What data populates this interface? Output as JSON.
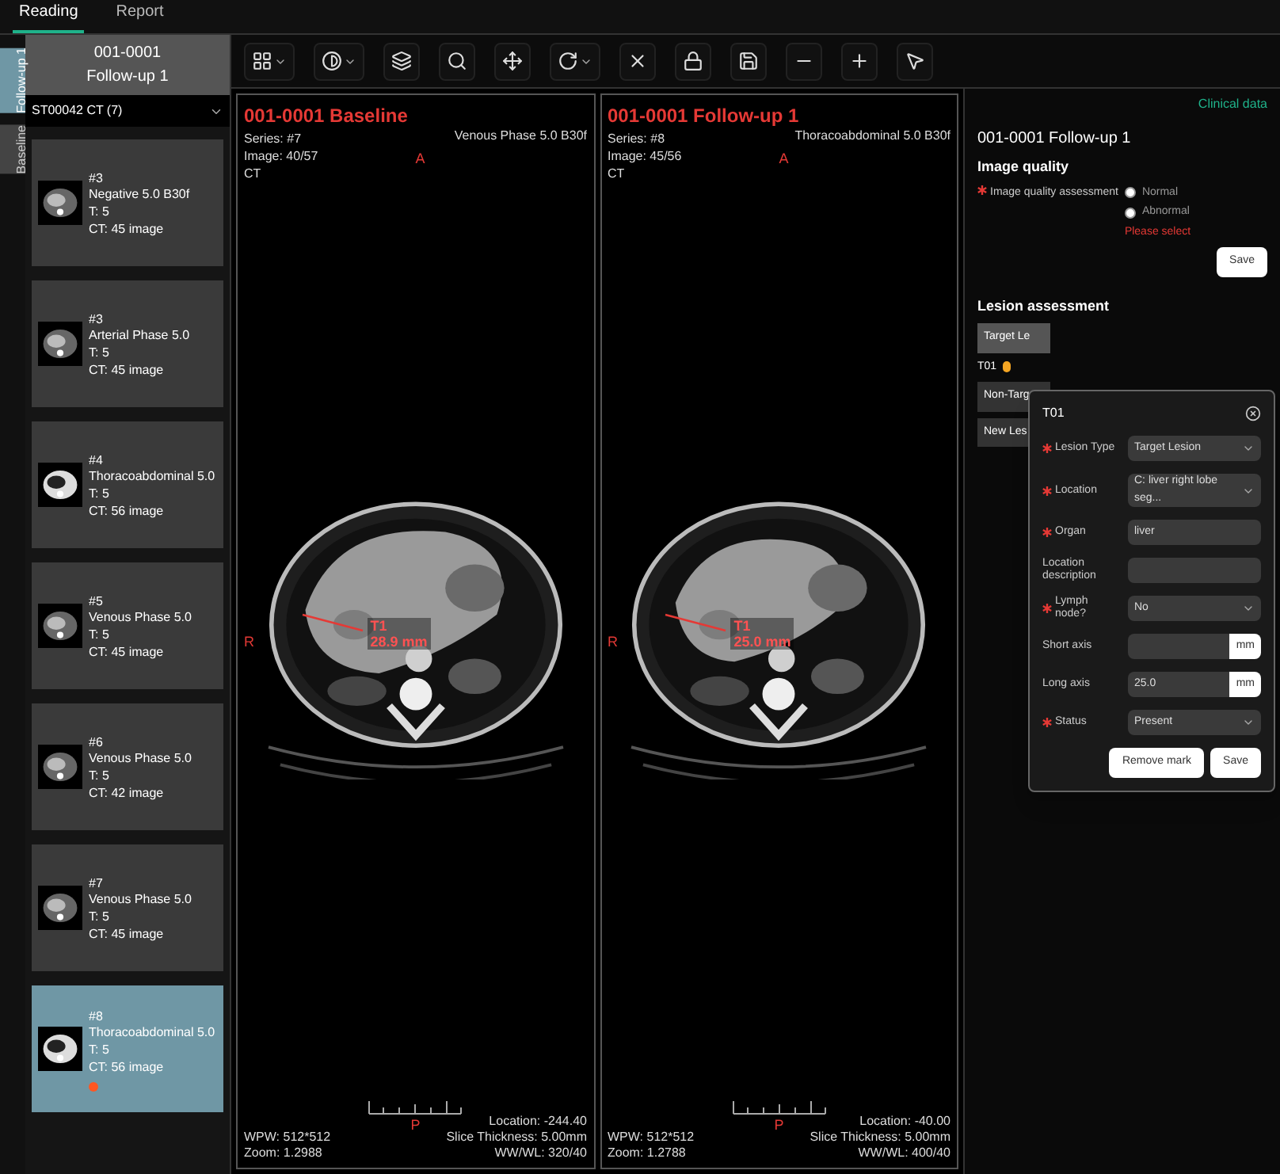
{
  "menu_tabs": [
    {
      "label": "Reading",
      "selected": true
    },
    {
      "label": "Report",
      "selected": false
    }
  ],
  "side_tabs": [
    {
      "label": "Follow-up 1",
      "selected": true
    },
    {
      "label": "Baseline",
      "selected": false
    }
  ],
  "study": {
    "id": "001-0001",
    "visit": "Follow-up 1",
    "series_select": "ST00042 CT (7)"
  },
  "series": [
    {
      "number": "#3",
      "name": "Negative 5.0 B30f",
      "thickness": "T: 5",
      "count": "CT: 45 image",
      "selected": false,
      "marked": false
    },
    {
      "number": "#3",
      "name": "Arterial Phase 5.0",
      "thickness": "T: 5",
      "count": "CT: 45 image",
      "selected": false,
      "marked": false
    },
    {
      "number": "#4",
      "name": "Thoracoabdominal 5.0",
      "thickness": "T: 5",
      "count": "CT: 56 image",
      "selected": false,
      "marked": false
    },
    {
      "number": "#5",
      "name": "Venous Phase 5.0",
      "thickness": "T: 5",
      "count": "CT: 45 image",
      "selected": false,
      "marked": false
    },
    {
      "number": "#6",
      "name": "Venous Phase 5.0",
      "thickness": "T: 5",
      "count": "CT: 42 image",
      "selected": false,
      "marked": false
    },
    {
      "number": "#7",
      "name": "Venous Phase 5.0",
      "thickness": "T: 5",
      "count": "CT: 45 image",
      "selected": false,
      "marked": false
    },
    {
      "number": "#8",
      "name": "Thoracoabdominal 5.0",
      "thickness": "T: 5",
      "count": "CT: 56 image",
      "selected": true,
      "marked": true
    }
  ],
  "toolbar": [
    {
      "kind": "layout",
      "menu": true
    },
    {
      "kind": "contrast",
      "menu": true
    },
    {
      "kind": "invert",
      "menu": false
    },
    {
      "kind": "zoom",
      "menu": false
    },
    {
      "kind": "pan",
      "menu": false
    },
    {
      "kind": "rotate",
      "menu": true
    },
    {
      "kind": "reset",
      "menu": false
    },
    {
      "kind": "lock",
      "menu": false
    },
    {
      "kind": "save",
      "menu": false
    },
    {
      "kind": "line",
      "menu": false
    },
    {
      "kind": "cross",
      "menu": false
    },
    {
      "kind": "pointer",
      "menu": false
    }
  ],
  "viewports": [
    {
      "title": "001-0001 Baseline",
      "info": [
        "Series: #7",
        "Image: 40/57",
        "CT"
      ],
      "series_name": "Venous Phase 5.0 B30f",
      "orient_top": "A",
      "orient_left": "R",
      "orient_bottom": "P",
      "bottom_left": [
        "WPW: 512*512",
        "Zoom: 1.2988"
      ],
      "bottom_right": [
        "Location: -244.40",
        "Slice Thickness: 5.00mm",
        "WW/WL: 320/40"
      ],
      "lesion": {
        "label": "T1",
        "measure": "28.9 mm"
      }
    },
    {
      "title": "001-0001 Follow-up 1",
      "info": [
        "Series: #8",
        "Image: 45/56",
        "CT"
      ],
      "series_name": "Thoracoabdominal 5.0 B30f",
      "orient_top": "A",
      "orient_left": "R",
      "orient_bottom": "P",
      "bottom_left": [
        "WPW: 512*512",
        "Zoom: 1.2788"
      ],
      "bottom_right": [
        "Location: -40.00",
        "Slice Thickness: 5.00mm",
        "WW/WL: 400/40"
      ],
      "lesion": {
        "label": "T1",
        "measure": "25.0 mm"
      }
    }
  ],
  "panel": {
    "link": "Clinical data",
    "title": "001-0001 Follow-up 1",
    "quality_heading": "Image quality",
    "quality_label": "Image quality assessment",
    "quality_required": true,
    "quality_options": [
      {
        "label": "Normal",
        "selected": false
      },
      {
        "label": "Abnormal",
        "selected": false
      }
    ],
    "quality_error": "Please select",
    "save": "Save",
    "lesion_heading": "Lesion assessment",
    "lesion_buttons": [
      {
        "label": "Target Le",
        "selected": true
      },
      {
        "label": "Non-Targ",
        "selected": false
      },
      {
        "label": "New Les",
        "selected": false
      }
    ],
    "lesion_items": [
      {
        "label": "T01",
        "color": "#f5a623"
      }
    ]
  },
  "popup": {
    "title": "T01",
    "fields": [
      {
        "kind": "select",
        "label": "Lesion Type",
        "required": true,
        "value": "Target Lesion"
      },
      {
        "kind": "select",
        "label": "Location",
        "required": true,
        "value": "C: liver right lobe seg..."
      },
      {
        "kind": "input",
        "label": "Organ",
        "required": true,
        "value": "liver"
      },
      {
        "kind": "input",
        "label": "Location description",
        "required": false
      },
      {
        "kind": "select",
        "label": "Lymph node?",
        "required": true,
        "value": "No"
      },
      {
        "kind": "measure",
        "label": "Short axis",
        "required": false,
        "unit": "mm"
      },
      {
        "kind": "measure",
        "label": "Long axis",
        "required": false,
        "value": "25.0",
        "unit": "mm"
      },
      {
        "kind": "select",
        "label": "Status",
        "required": true,
        "value": "Present"
      }
    ],
    "buttons": [
      "Remove mark",
      "Save"
    ]
  }
}
